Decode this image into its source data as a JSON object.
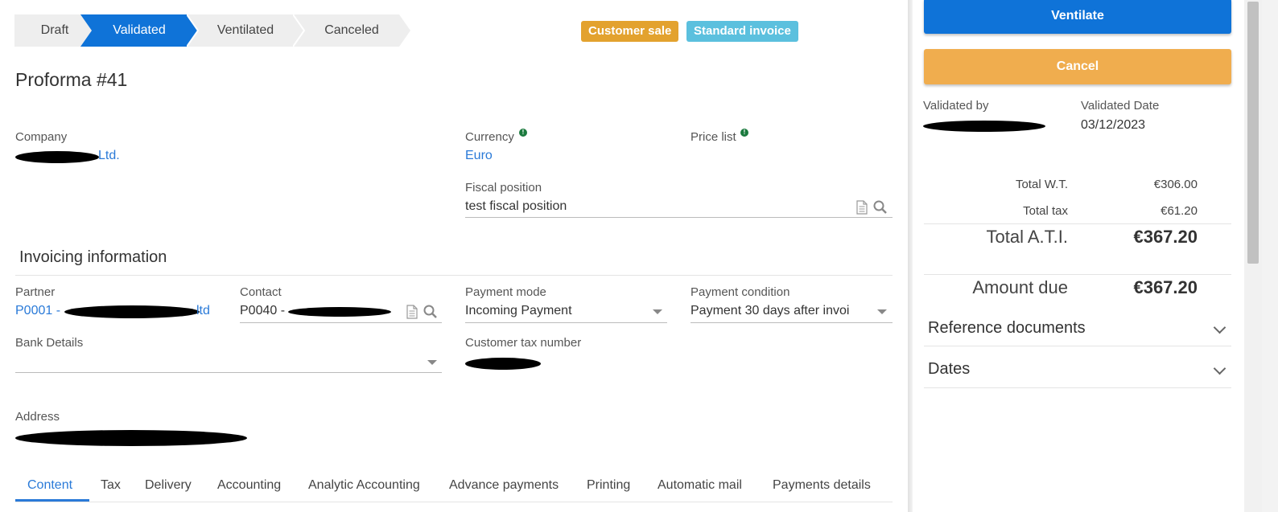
{
  "status_steps": [
    {
      "label": "Draft",
      "active": false
    },
    {
      "label": "Validated",
      "active": true
    },
    {
      "label": "Ventilated",
      "active": false
    },
    {
      "label": "Canceled",
      "active": false
    }
  ],
  "badges": {
    "customer_sale": {
      "label": "Customer sale",
      "color": "#e3a22e"
    },
    "standard_invoice": {
      "label": "Standard invoice",
      "color": "#5bc0de"
    }
  },
  "title": "Proforma #41",
  "company": {
    "label": "Company",
    "value": "Ltd."
  },
  "currency": {
    "label": "Currency",
    "value": "Euro"
  },
  "price_list": {
    "label": "Price list"
  },
  "fiscal_position": {
    "label": "Fiscal position",
    "value": "test fiscal position"
  },
  "invoicing_title": "Invoicing information",
  "partner": {
    "label": "Partner",
    "prefix": "P0001 -",
    "suffix": "ltd"
  },
  "contact": {
    "label": "Contact",
    "prefix": "P0040 -"
  },
  "payment_mode": {
    "label": "Payment mode",
    "value": "Incoming Payment"
  },
  "payment_condition": {
    "label": "Payment condition",
    "value": "Payment 30 days after invoi"
  },
  "bank_details": {
    "label": "Bank Details",
    "value": ""
  },
  "customer_tax_number": {
    "label": "Customer tax number"
  },
  "address": {
    "label": "Address"
  },
  "tabs": [
    {
      "label": "Content",
      "active": true
    },
    {
      "label": "Tax"
    },
    {
      "label": "Delivery"
    },
    {
      "label": "Accounting"
    },
    {
      "label": "Analytic Accounting"
    },
    {
      "label": "Advance payments"
    },
    {
      "label": "Printing"
    },
    {
      "label": "Automatic mail"
    },
    {
      "label": "Payments details"
    }
  ],
  "actions": {
    "ventilate": {
      "label": "Ventilate",
      "color": "#0f73d8"
    },
    "cancel": {
      "label": "Cancel",
      "color": "#f0ad4e"
    }
  },
  "validated_by": {
    "label": "Validated by"
  },
  "validated_date": {
    "label": "Validated Date",
    "value": "03/12/2023"
  },
  "totals": {
    "total_wt": {
      "label": "Total W.T.",
      "value": "€306.00"
    },
    "total_tax": {
      "label": "Total tax",
      "value": "€61.20"
    },
    "total_ati": {
      "label": "Total A.T.I.",
      "value": "€367.20"
    },
    "amount_due": {
      "label": "Amount due",
      "value": "€367.20"
    }
  },
  "panels": [
    {
      "label": "Reference documents"
    },
    {
      "label": "Dates"
    }
  ],
  "colors": {
    "accent": "#0f73d8",
    "link": "#2a7ad8",
    "step_inactive": "#eeeeee"
  },
  "icons": [
    "document-icon",
    "search-icon",
    "info-icon",
    "caret-down-icon",
    "chevron-down-icon"
  ]
}
